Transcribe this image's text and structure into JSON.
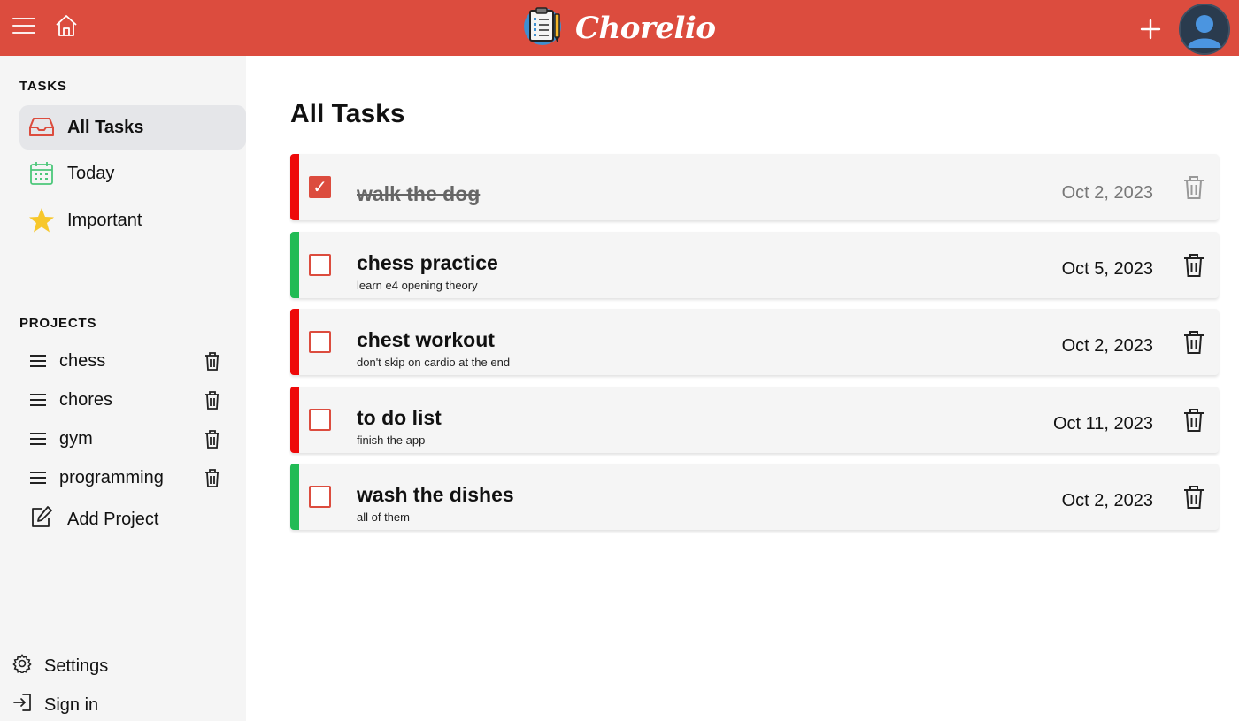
{
  "header": {
    "brand": "Chorelio",
    "colors": {
      "bar": "#dc4c3e"
    },
    "icons": [
      "hamburger-icon",
      "home-icon",
      "clipboard-logo-icon",
      "plus-icon",
      "avatar-icon"
    ]
  },
  "sidebar": {
    "tasks_title": "TASKS",
    "nav": [
      {
        "label": "All Tasks",
        "icon": "inbox-icon",
        "active": true
      },
      {
        "label": "Today",
        "icon": "calendar-icon",
        "active": false
      },
      {
        "label": "Important",
        "icon": "star-icon",
        "active": false
      }
    ],
    "projects_title": "PROJECTS",
    "projects": [
      {
        "label": "chess"
      },
      {
        "label": "chores"
      },
      {
        "label": "gym"
      },
      {
        "label": "programming"
      }
    ],
    "add_project": "Add Project",
    "settings": "Settings",
    "signin": "Sign in"
  },
  "main": {
    "title": "All Tasks",
    "tasks": [
      {
        "title": "walk the dog",
        "desc": "",
        "date": "Oct 2, 2023",
        "done": true,
        "priority_color": "#ee0a0a"
      },
      {
        "title": "chess practice",
        "desc": "learn e4 opening theory",
        "date": "Oct 5, 2023",
        "done": false,
        "priority_color": "#22bb55"
      },
      {
        "title": "chest workout",
        "desc": "don't skip on cardio at the end",
        "date": "Oct 2, 2023",
        "done": false,
        "priority_color": "#ee0a0a"
      },
      {
        "title": "to do list",
        "desc": "finish the app",
        "date": "Oct 11, 2023",
        "done": false,
        "priority_color": "#ee0a0a"
      },
      {
        "title": "wash the dishes",
        "desc": "all of them",
        "date": "Oct 2, 2023",
        "done": false,
        "priority_color": "#22bb55"
      }
    ]
  }
}
